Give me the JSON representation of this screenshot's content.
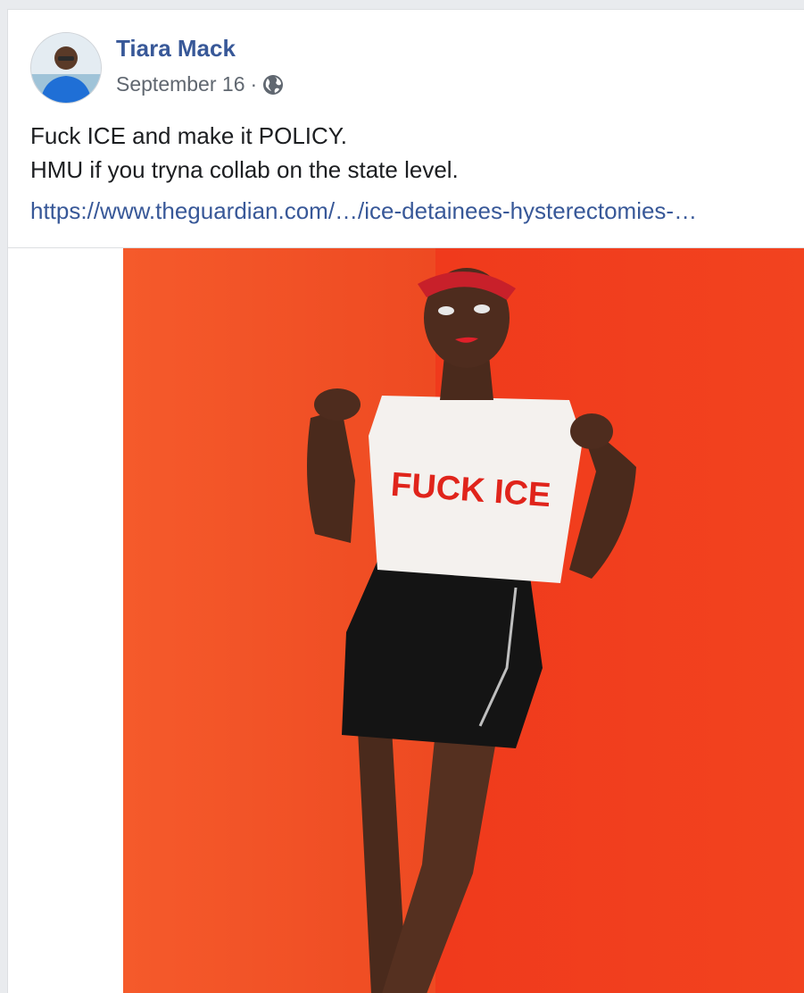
{
  "post": {
    "author": "Tiara Mack",
    "date": "September 16",
    "separator": "·",
    "privacy_icon": "globe-icon",
    "text_lines": [
      "Fuck ICE and make it POLICY.",
      "HMU if you tryna collab on the state level."
    ],
    "link": "https://www.theguardian.com/…/ice-detainees-hysterectomies-…"
  },
  "photo": {
    "shirt_text": "FUCK ICE"
  },
  "colors": {
    "author": "#385898",
    "link": "#385898",
    "meta": "#606770",
    "background": "#e9ebee",
    "photo_wall": "#f0421f"
  }
}
